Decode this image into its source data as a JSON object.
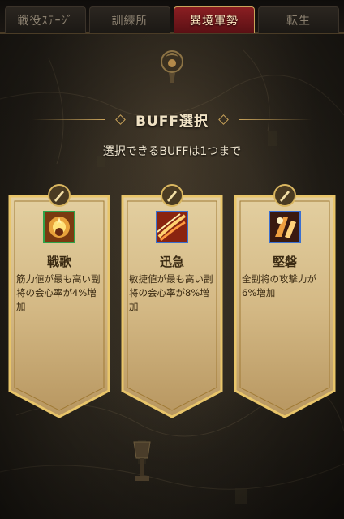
{
  "tabs": [
    {
      "label": "戦役ｽﾃｰｼﾞ",
      "active": false
    },
    {
      "label": "訓練所",
      "active": false
    },
    {
      "label": "異境軍勢",
      "active": true
    },
    {
      "label": "転生",
      "active": false
    }
  ],
  "dialog": {
    "title": "BUFF選択",
    "subtitle": "選択できるBUFFは1つまで"
  },
  "cards": [
    {
      "name": "戦歌",
      "icon": "war-song-icon",
      "description": "筋力値が最も高い副将の会心率が4%増加",
      "icon_border_color": "#2fa34a"
    },
    {
      "name": "迅急",
      "icon": "swift-icon",
      "description": "敏捷値が最も高い副将の会心率が8%増加",
      "icon_border_color": "#3a6fd0"
    },
    {
      "name": "堅磐",
      "icon": "steadfast-icon",
      "description": "全副将の攻撃力が6%増加",
      "icon_border_color": "#3a6fd0"
    }
  ],
  "colors": {
    "accent_gold": "#c9a35a",
    "tab_active": "#8a1e22",
    "card_text": "#3a2a12"
  }
}
